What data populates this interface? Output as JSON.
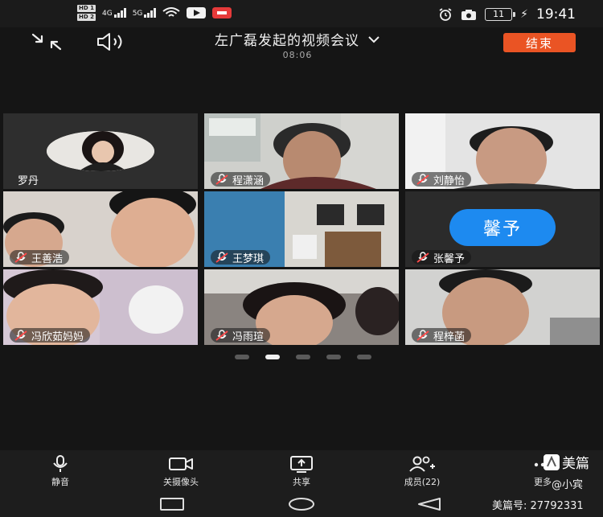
{
  "status_bar": {
    "hd1": "HD 1",
    "hd2": "HD 2",
    "net1": "4G",
    "net2": "5G",
    "battery": "11",
    "time": "19:41"
  },
  "header": {
    "title": "左广磊发起的视频会议",
    "duration": "08:06",
    "end_label": "结束"
  },
  "participants": [
    {
      "name": "罗丹",
      "muted": false
    },
    {
      "name": "程潇涵",
      "muted": true
    },
    {
      "name": "刘静怡",
      "muted": true
    },
    {
      "name": "王善浩",
      "muted": true
    },
    {
      "name": "王梦琪",
      "muted": true
    },
    {
      "name": "张馨予",
      "muted": true,
      "avatar_text": "馨予"
    },
    {
      "name": "冯欣茹妈妈",
      "muted": true
    },
    {
      "name": "冯雨瑄",
      "muted": true
    },
    {
      "name": "程梓菡",
      "muted": true
    }
  ],
  "pager": {
    "count": 5,
    "active": 1
  },
  "toolbar": {
    "mute": "静音",
    "camera": "关摄像头",
    "share": "共享",
    "members": "成员(22)",
    "more": "更多"
  },
  "watermark": {
    "brand": "美篇",
    "author": "@小宾",
    "id": "美篇号: 27792331"
  },
  "colors": {
    "end_button": "#ea5424",
    "avatar_blue": "#1d8af0",
    "background": "#151515"
  }
}
